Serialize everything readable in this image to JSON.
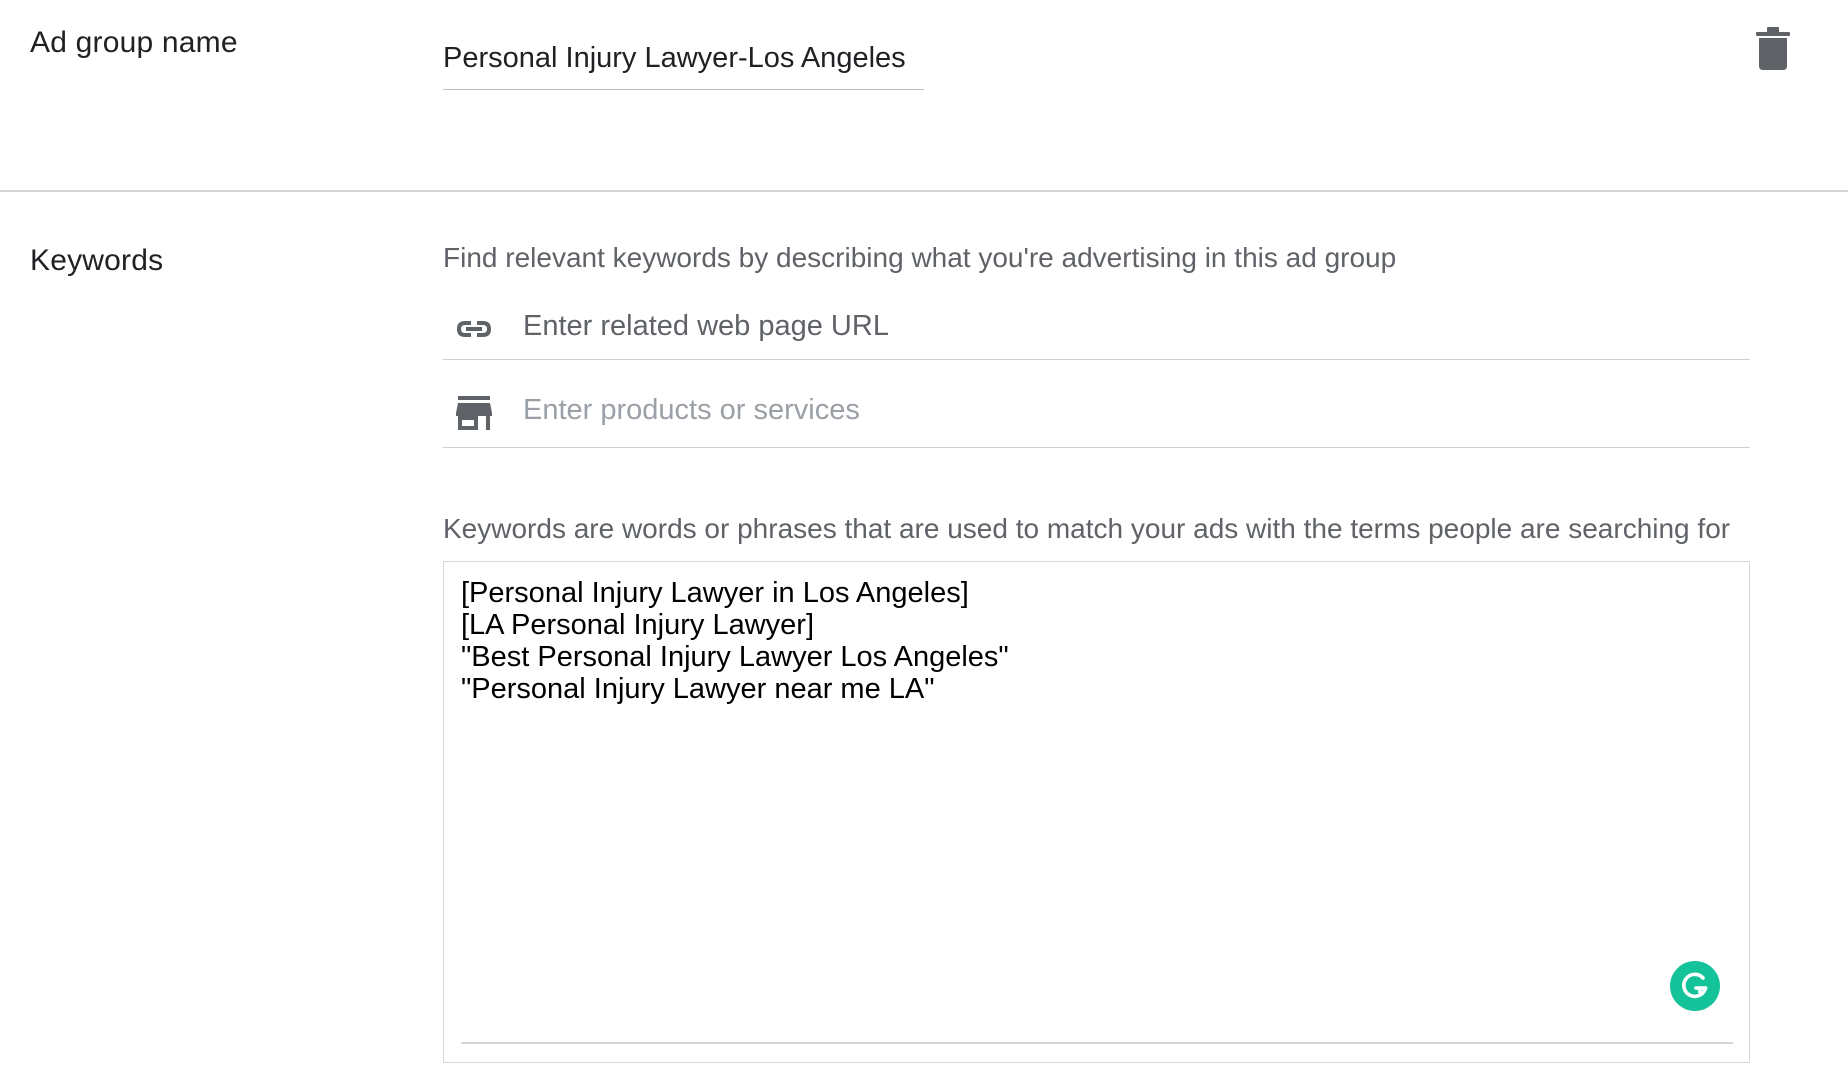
{
  "ad_group": {
    "label": "Ad group name",
    "value": "Personal Injury Lawyer-Los Angeles",
    "delete_icon": "trash-icon"
  },
  "keywords": {
    "label": "Keywords",
    "find_helper": "Find relevant keywords by describing what you're advertising in this ad group",
    "url_field": {
      "icon": "link-icon",
      "placeholder": "Enter related web page URL"
    },
    "products_field": {
      "icon": "store-icon",
      "placeholder": "Enter products or services"
    },
    "match_helper": "Keywords are words or phrases that are used to match your ads with the terms people are searching for",
    "entries": [
      "[Personal Injury Lawyer in Los Angeles]",
      "[LA Personal Injury Lawyer]",
      "\"Best Personal Injury Lawyer Los Angeles\"",
      "\"Personal Injury Lawyer near me LA\""
    ],
    "grammarly_icon": "grammarly-icon"
  },
  "colors": {
    "grammarly": "#15c39a",
    "text": "#202124",
    "secondary_text": "#5f6368",
    "placeholder": "#9aa0a6",
    "divider": "#d2d2d2"
  }
}
